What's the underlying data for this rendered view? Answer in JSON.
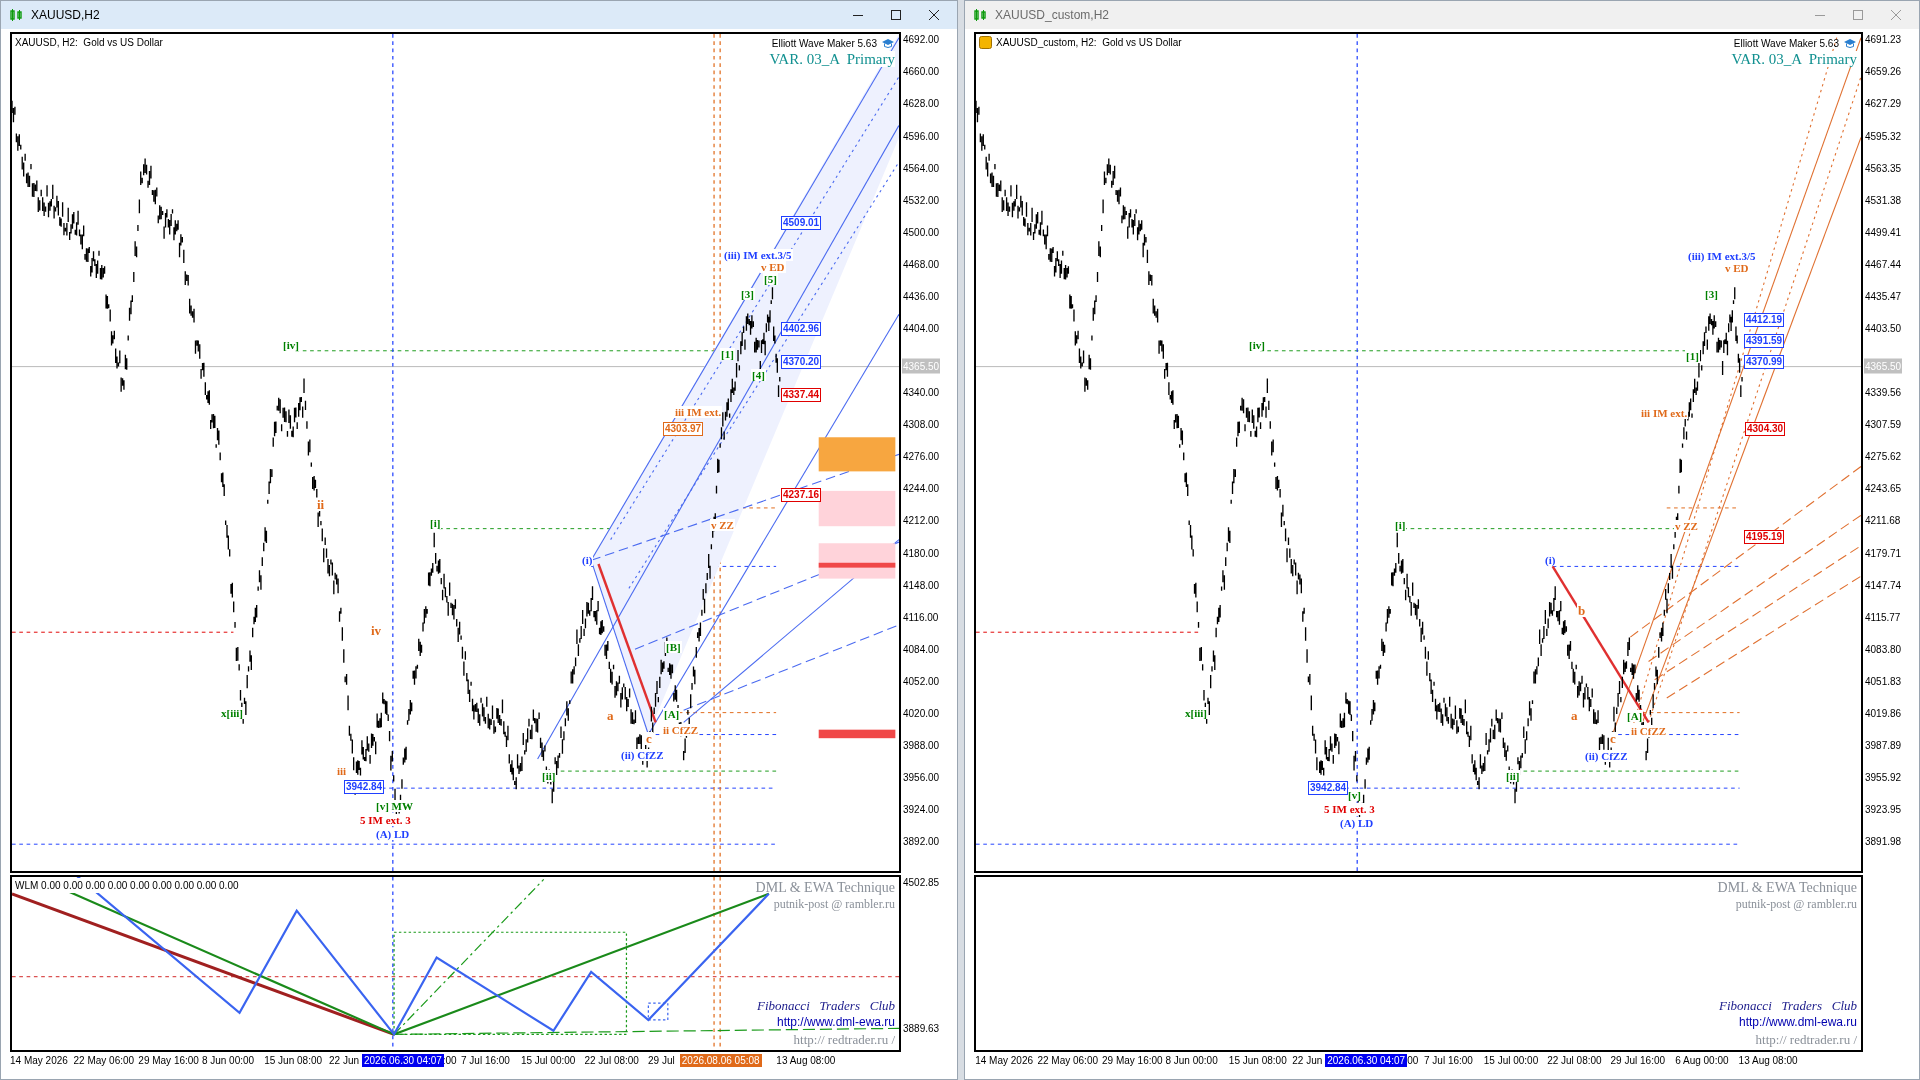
{
  "windows": [
    {
      "title": "XAUUSD,H2",
      "active": true,
      "symbol_label": "XAUUSD, H2:  Gold vs US Dollar",
      "indicator_name": "Elliott Wave Maker 5.63",
      "variant": "VAR. 03_A  Primary",
      "price_ticks": [
        "4692.00",
        "4660.00",
        "4628.00",
        "4596.00",
        "4564.00",
        "4532.00",
        "4500.00",
        "4468.00",
        "4436.00",
        "4404.00",
        "4340.00",
        "4308.00",
        "4276.00",
        "4244.00",
        "4212.00",
        "4180.00",
        "4148.00",
        "4116.00",
        "4084.00",
        "4052.00",
        "4020.00",
        "3988.00",
        "3956.00",
        "3924.00",
        "3892.00"
      ],
      "current_price": "4365.50",
      "wave_labels": [
        {
          "text": "[iv]",
          "color": "#008000"
        },
        {
          "text": "ii",
          "color": "#e06a1a"
        },
        {
          "text": "iv",
          "color": "#e06a1a"
        },
        {
          "text": "x[iii]",
          "color": "#008000"
        },
        {
          "text": "[i]",
          "color": "#008000"
        },
        {
          "text": "iii",
          "color": "#e06a1a"
        },
        {
          "text": "[v] MW",
          "color": "#008000"
        },
        {
          "text": "5 IM ext. 3",
          "color": "#e00000"
        },
        {
          "text": "(A) LD",
          "color": "#2040ff"
        },
        {
          "text": "[ii]",
          "color": "#008000"
        },
        {
          "text": "(i)",
          "color": "#2040ff"
        },
        {
          "text": "[B]",
          "color": "#008000"
        },
        {
          "text": "a",
          "color": "#e06a1a"
        },
        {
          "text": "[A]",
          "color": "#008000"
        },
        {
          "text": "ii CfZZ",
          "color": "#e06a1a"
        },
        {
          "text": "c",
          "color": "#e06a1a"
        },
        {
          "text": "(ii) CfZZ",
          "color": "#2040ff"
        },
        {
          "text": "iii IM ext.",
          "color": "#e06a1a"
        },
        {
          "text": "v ZZ",
          "color": "#e06a1a"
        },
        {
          "text": "(iii) IM ext.3/5",
          "color": "#2040ff"
        },
        {
          "text": "v ED",
          "color": "#e06a1a"
        },
        {
          "text": "[5]",
          "color": "#008000"
        },
        {
          "text": "[3]",
          "color": "#008000"
        },
        {
          "text": "[1]",
          "color": "#008000"
        },
        {
          "text": "[4]",
          "color": "#008000"
        }
      ],
      "price_tags": [
        {
          "text": "4303.97",
          "color": "#e06a1a"
        },
        {
          "text": "4509.01",
          "color": "#2040ff"
        },
        {
          "text": "4402.96",
          "color": "#2040ff"
        },
        {
          "text": "4370.20",
          "color": "#2040ff"
        },
        {
          "text": "4337.44",
          "color": "#e00000"
        },
        {
          "text": "4237.16",
          "color": "#e00000"
        },
        {
          "text": "3942.84",
          "color": "#2040ff"
        }
      ],
      "indicator_legend": "WLM 0.00 0.00 0.00 0.00 0.00 0.00 0.00 0.00 0.00",
      "indicator_ticks": [
        "4502.85",
        "3889.63"
      ],
      "credits": [
        {
          "text": "DML & EWA Technique",
          "kind": "title"
        },
        {
          "text": "putnik-post @ rambler.ru",
          "kind": "email"
        },
        {
          "text": "Fibonacci   Traders   Club",
          "kind": "club"
        },
        {
          "text": "http://www.dml-ewa.ru",
          "kind": "link"
        },
        {
          "text": "http:// redtrader.ru /",
          "kind": "site"
        }
      ],
      "time_labels": [
        {
          "text": "14 May 2026",
          "kind": "tick"
        },
        {
          "text": "22 May 06:00",
          "kind": "tick"
        },
        {
          "text": "29 May 16:00",
          "kind": "tick"
        },
        {
          "text": "8 Jun 00:00",
          "kind": "tick"
        },
        {
          "text": "15 Jun 08:00",
          "kind": "tick"
        },
        {
          "text": "22 Jun",
          "kind": "tick"
        },
        {
          "text": "2026.06.30 04:07",
          "kind": "cursor"
        },
        {
          "text": ":00",
          "kind": "tick"
        },
        {
          "text": "7 Jul 16:00",
          "kind": "tick"
        },
        {
          "text": "15 Jul 00:00",
          "kind": "tick"
        },
        {
          "text": "22 Jul 08:00",
          "kind": "tick"
        },
        {
          "text": "29 Jul",
          "kind": "tick"
        },
        {
          "text": "2026.08.06 05:08",
          "kind": "marker"
        },
        {
          "text": "13 Aug 08:00",
          "kind": "tick"
        }
      ]
    },
    {
      "title": "XAUUSD_custom,H2",
      "active": false,
      "symbol_label": "XAUUSD_custom, H2:  Gold vs US Dollar",
      "indicator_name": "Elliott Wave Maker 5.63",
      "variant": "VAR. 03_A  Primary",
      "price_ticks": [
        "4691.23",
        "4659.26",
        "4627.29",
        "4595.32",
        "4563.35",
        "4531.38",
        "4499.41",
        "4467.44",
        "4435.47",
        "4403.50",
        "4339.56",
        "4307.59",
        "4275.62",
        "4243.65",
        "4211.68",
        "4179.71",
        "4147.74",
        "4115.77",
        "4083.80",
        "4051.83",
        "4019.86",
        "3987.89",
        "3955.92",
        "3923.95",
        "3891.98"
      ],
      "current_price": "4365.50",
      "wave_labels": [
        {
          "text": "[iv]",
          "color": "#008000"
        },
        {
          "text": "x[iii]",
          "color": "#008000"
        },
        {
          "text": "[i]",
          "color": "#008000"
        },
        {
          "text": "[v]",
          "color": "#008000"
        },
        {
          "text": "5 IM ext. 3",
          "color": "#e00000"
        },
        {
          "text": "(A) LD",
          "color": "#2040ff"
        },
        {
          "text": "[ii]",
          "color": "#008000"
        },
        {
          "text": "(i)",
          "color": "#2040ff"
        },
        {
          "text": "b",
          "color": "#e06a1a"
        },
        {
          "text": "a",
          "color": "#e06a1a"
        },
        {
          "text": "[A]",
          "color": "#008000"
        },
        {
          "text": "ii CfZZ",
          "color": "#e06a1a"
        },
        {
          "text": "c",
          "color": "#e06a1a"
        },
        {
          "text": "(ii) CfZZ",
          "color": "#2040ff"
        },
        {
          "text": "[1]",
          "color": "#008000"
        },
        {
          "text": "iii IM ext.",
          "color": "#e06a1a"
        },
        {
          "text": "v ZZ",
          "color": "#e06a1a"
        },
        {
          "text": "(iii) IM ext.3/5",
          "color": "#2040ff"
        },
        {
          "text": "v ED",
          "color": "#e06a1a"
        },
        {
          "text": "[3]",
          "color": "#008000"
        }
      ],
      "price_tags": [
        {
          "text": "3942.84",
          "color": "#2040ff"
        },
        {
          "text": "4412.19",
          "color": "#2040ff"
        },
        {
          "text": "4391.59",
          "color": "#2040ff"
        },
        {
          "text": "4370.99",
          "color": "#2040ff"
        },
        {
          "text": "4304.30",
          "color": "#e00000"
        },
        {
          "text": "4195.19",
          "color": "#e00000"
        }
      ],
      "credits": [
        {
          "text": "DML & EWA Technique",
          "kind": "title"
        },
        {
          "text": "putnik-post @ rambler.ru",
          "kind": "email"
        },
        {
          "text": "Fibonacci   Traders   Club",
          "kind": "club"
        },
        {
          "text": "http://www.dml-ewa.ru",
          "kind": "link"
        },
        {
          "text": "http:// redtrader.ru /",
          "kind": "site"
        }
      ],
      "time_labels": [
        {
          "text": "14 May 2026",
          "kind": "tick"
        },
        {
          "text": "22 May 06:00",
          "kind": "tick"
        },
        {
          "text": "29 May 16:00",
          "kind": "tick"
        },
        {
          "text": "8 Jun 00:00",
          "kind": "tick"
        },
        {
          "text": "15 Jun 08:00",
          "kind": "tick"
        },
        {
          "text": "22 Jun",
          "kind": "tick"
        },
        {
          "text": "2026.06.30 04:07",
          "kind": "cursor"
        },
        {
          "text": ":00",
          "kind": "tick"
        },
        {
          "text": "7 Jul 16:00",
          "kind": "tick"
        },
        {
          "text": "15 Jul 00:00",
          "kind": "tick"
        },
        {
          "text": "22 Jul 08:00",
          "kind": "tick"
        },
        {
          "text": "29 Jul 16:00",
          "kind": "tick"
        },
        {
          "text": "6 Aug 00:00",
          "kind": "tick"
        },
        {
          "text": "13 Aug 08:00",
          "kind": "tick"
        }
      ]
    }
  ]
}
